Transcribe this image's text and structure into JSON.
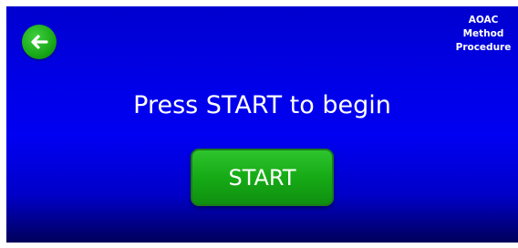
{
  "header": {
    "back_icon": "back-arrow-icon",
    "note_lines": [
      "AOAC",
      "Method",
      "Procedure"
    ]
  },
  "main": {
    "prompt": "Press START to begin",
    "start_label": "START"
  },
  "colors": {
    "background": "#0000e6",
    "button_green": "#16ab16",
    "text": "#ffffff"
  }
}
